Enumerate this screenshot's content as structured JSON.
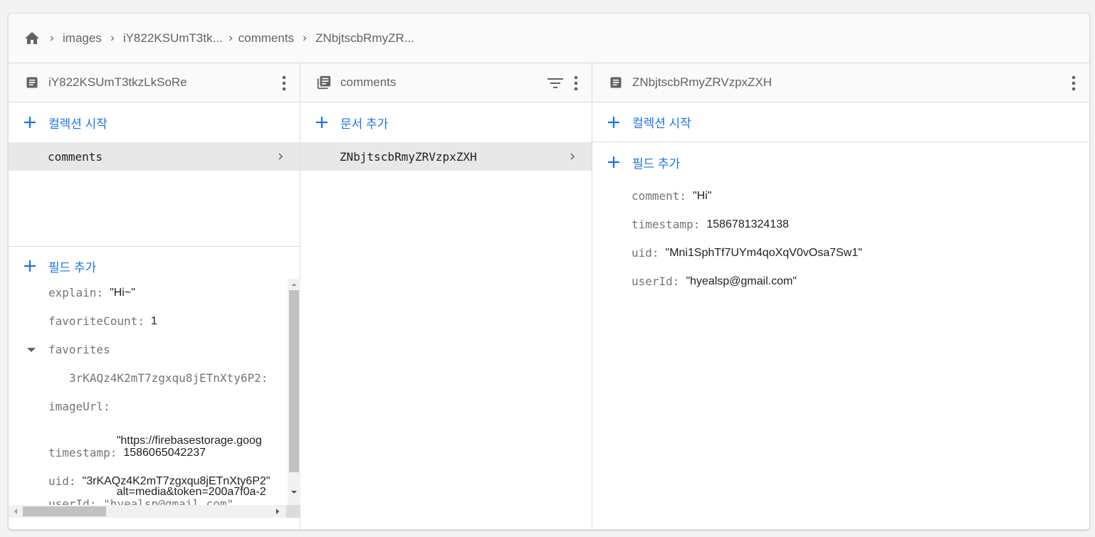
{
  "breadcrumb": {
    "items": [
      "images",
      "iY822KSUmT3tk...",
      "comments",
      "ZNbjtscbRmyZR..."
    ]
  },
  "col1": {
    "title": "iY822KSUmT3tkzLkSoRe",
    "start_collection": "컬렉션 시작",
    "item": "comments",
    "add_field": "필드 추가",
    "fields": {
      "explain_key": "explain:",
      "explain_val": "\"Hi~\"",
      "favcount_key": "favoriteCount:",
      "favcount_val": "1",
      "favorites_key": "favorites",
      "fav_sub_key": "3rKAQz4K2mT7zgxqu8jETnXty6P2:",
      "imageurl_key": "imageUrl:",
      "imageurl_val1": "\"https://firebasestorage.goog",
      "imageurl_val2": "alt=media&token=200a7f0a-2",
      "timestamp_key": "timestamp:",
      "timestamp_val": "1586065042237",
      "uid_key": "uid:",
      "uid_val": "\"3rKAQz4K2mT7zgxqu8jETnXty6P2\"",
      "userid_partial": "userId: \"hyealsp@gmail.com\""
    }
  },
  "col2": {
    "title": "comments",
    "add_document": "문서 추가",
    "item": "ZNbjtscbRmyZRVzpxZXH"
  },
  "col3": {
    "title": "ZNbjtscbRmyZRVzpxZXH",
    "start_collection": "컬렉션 시작",
    "add_field": "필드 추가",
    "fields": {
      "comment_key": "comment:",
      "comment_val": "\"Hi\"",
      "timestamp_key": "timestamp:",
      "timestamp_val": "1586781324138",
      "uid_key": "uid:",
      "uid_val": "\"Mni1SphTf7UYm4qoXqV0vOsa7Sw1\"",
      "userid_key": "userId:",
      "userid_val": "\"hyealsp@gmail.com\""
    }
  },
  "colors": {
    "accent": "#1a73e8",
    "icon_gray": "#5f6368",
    "key_gray": "#757575",
    "selected_bg": "#e8e8e8"
  },
  "icons": [
    "home-icon",
    "chevron-right-icon",
    "document-icon",
    "collection-icon",
    "more-vert-icon",
    "filter-icon",
    "plus-icon",
    "arrow-drop-down-icon"
  ]
}
